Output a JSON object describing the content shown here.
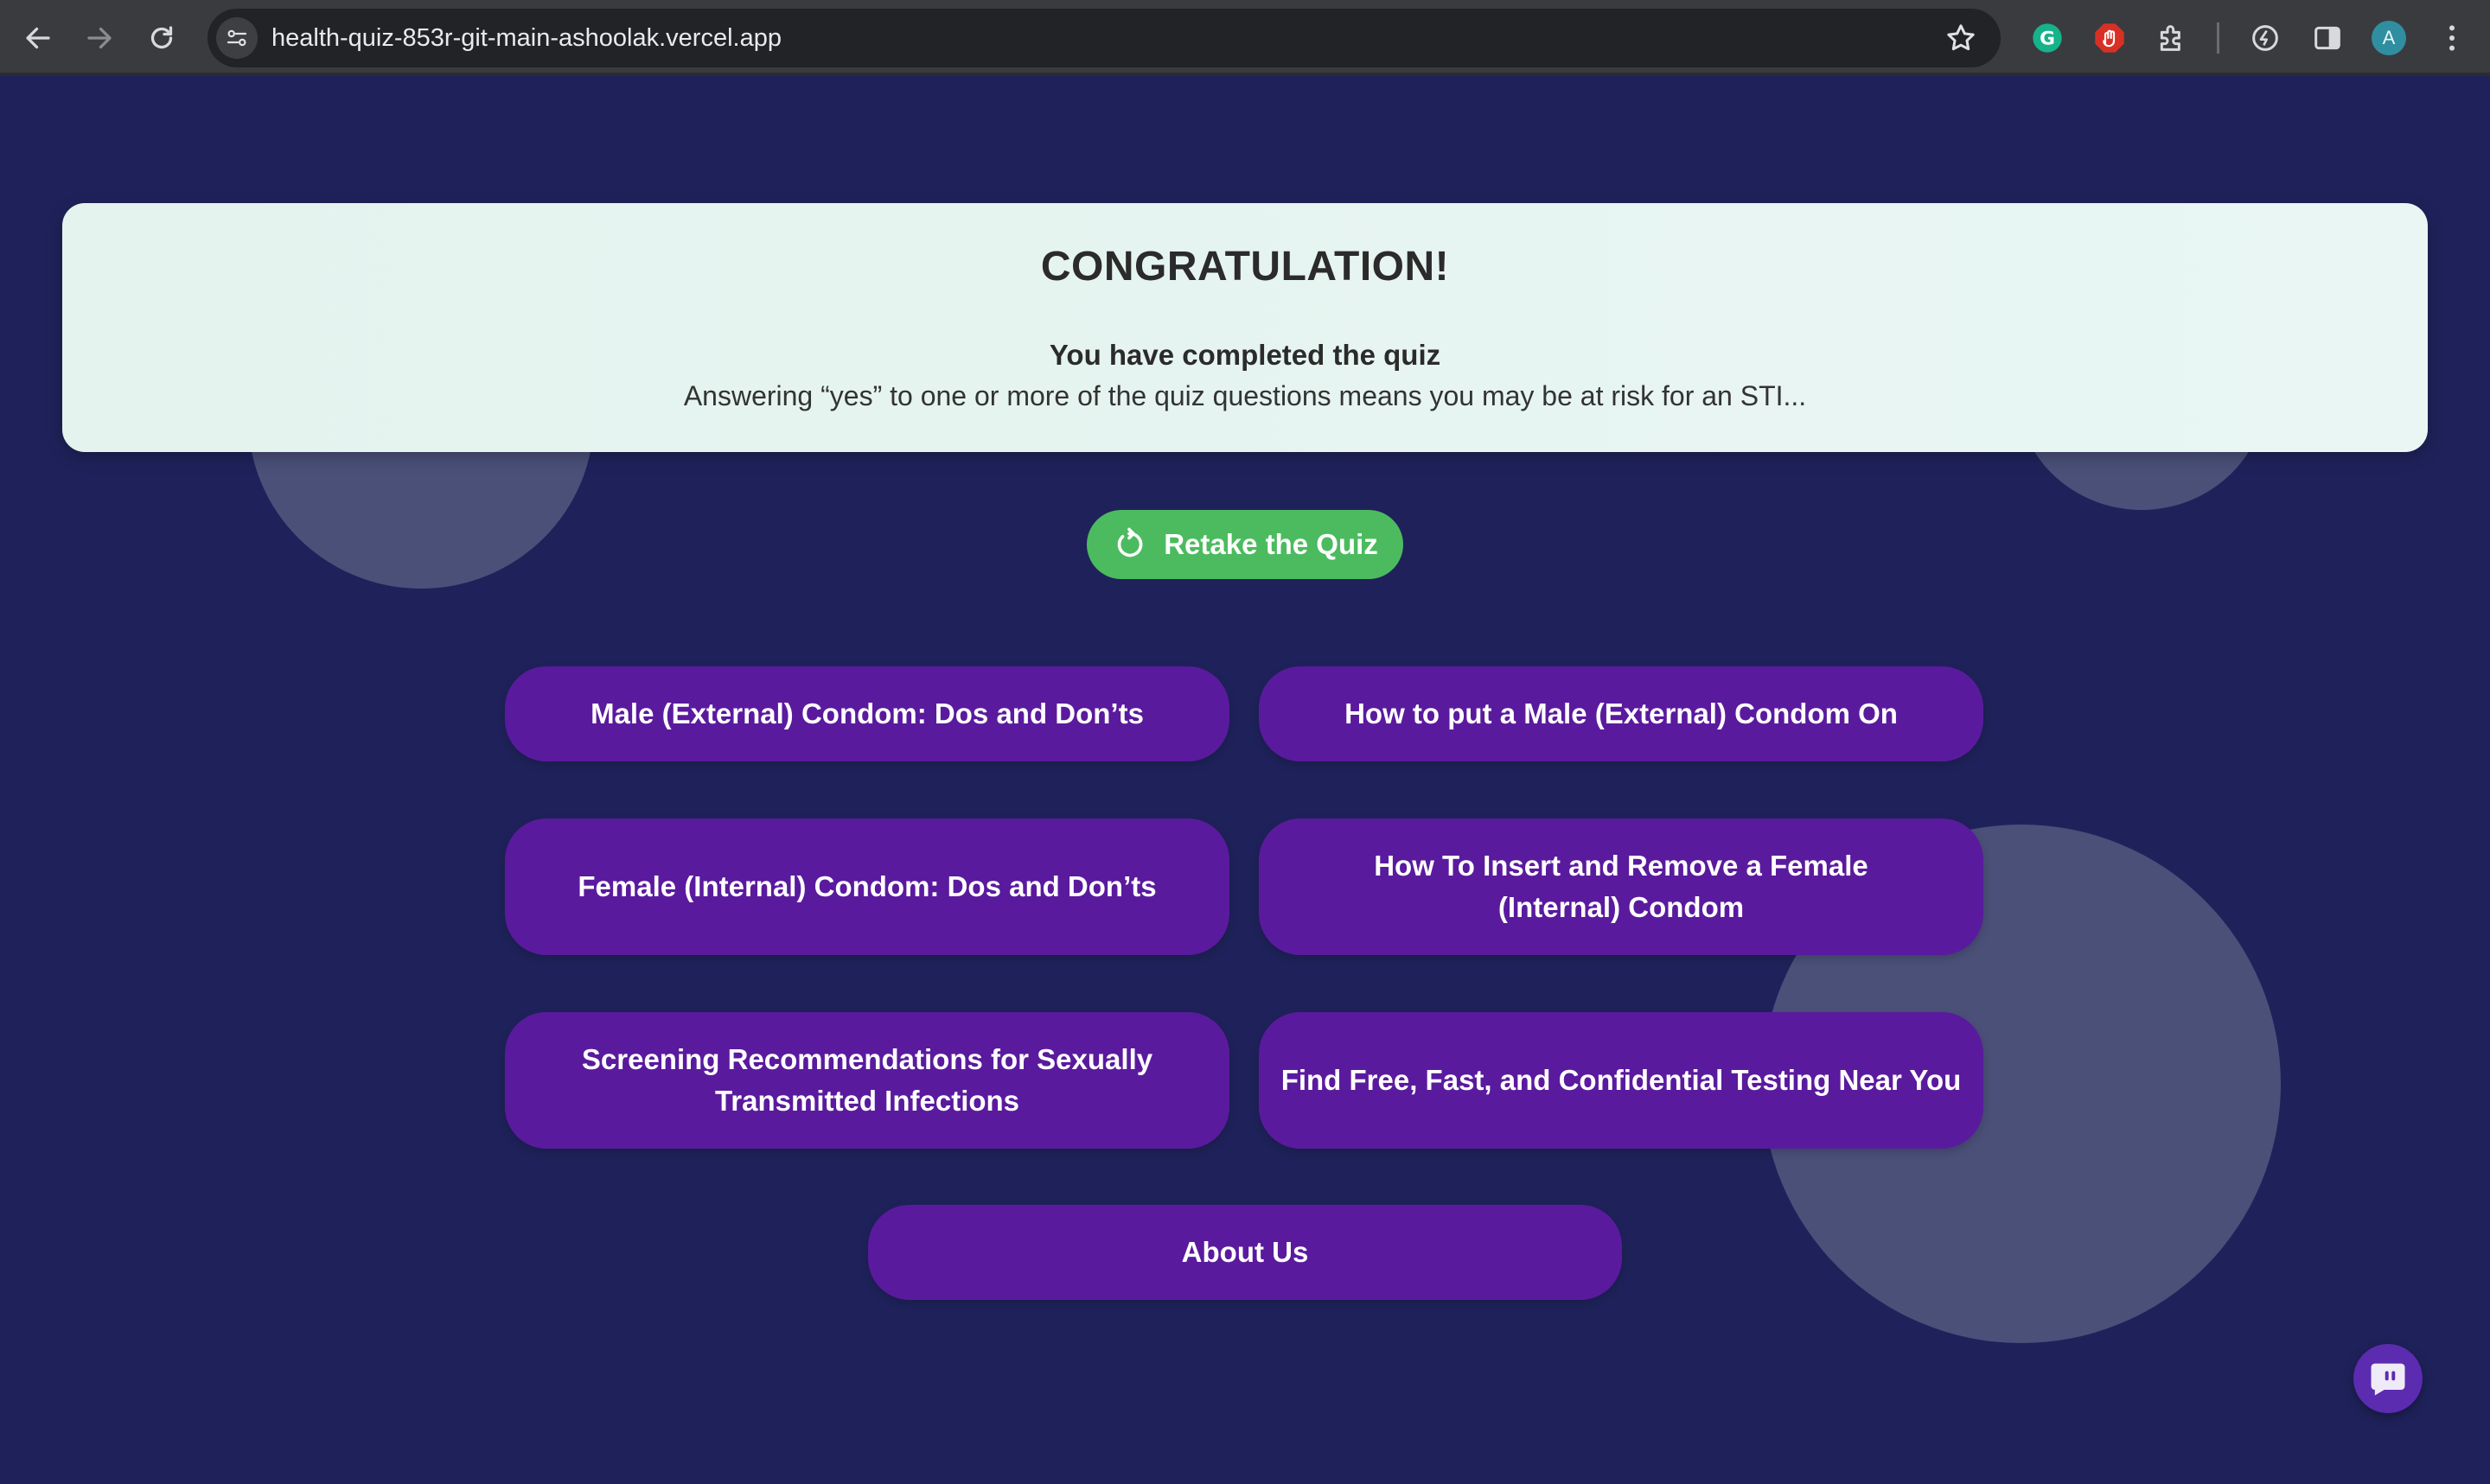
{
  "browser": {
    "url": "health-quiz-853r-git-main-ashoolak.vercel.app",
    "profile_initial": "A",
    "icons": [
      "back-icon",
      "forward-icon",
      "reload-icon",
      "site-info-icon",
      "star-icon",
      "grammarly-icon",
      "adblock-icon",
      "extensions-icon",
      "performance-icon",
      "side-panel-icon",
      "menu-icon"
    ]
  },
  "result": {
    "title": "CONGRATULATION!",
    "subtitle": "You have completed the quiz",
    "message": "Answering “yes” to one or more of the quiz questions means you may be at risk for an STI..."
  },
  "retake": {
    "label": "Retake the Quiz",
    "icon": "restart-icon"
  },
  "resources": [
    {
      "label": "Male (External) Condom: Dos and Don’ts"
    },
    {
      "label": "How to put a Male (External) Condom On"
    },
    {
      "label": "Female (Internal) Condom: Dos and Don’ts"
    },
    {
      "label": "How To Insert and Remove a Female (Internal) Condom"
    },
    {
      "label": "Screening Recommendations for Sexually Transmitted Infections"
    },
    {
      "label": "Find Free, Fast, and Confidential Testing Near You"
    }
  ],
  "about": {
    "label": "About Us"
  },
  "chat": {
    "icon": "chat-icon"
  },
  "colors": {
    "background": "#1f225a",
    "card": "#e6f4f0",
    "retake_button": "#4cbb5f",
    "link_button": "#5a1a9e",
    "decor_circle": "#4b5079"
  }
}
